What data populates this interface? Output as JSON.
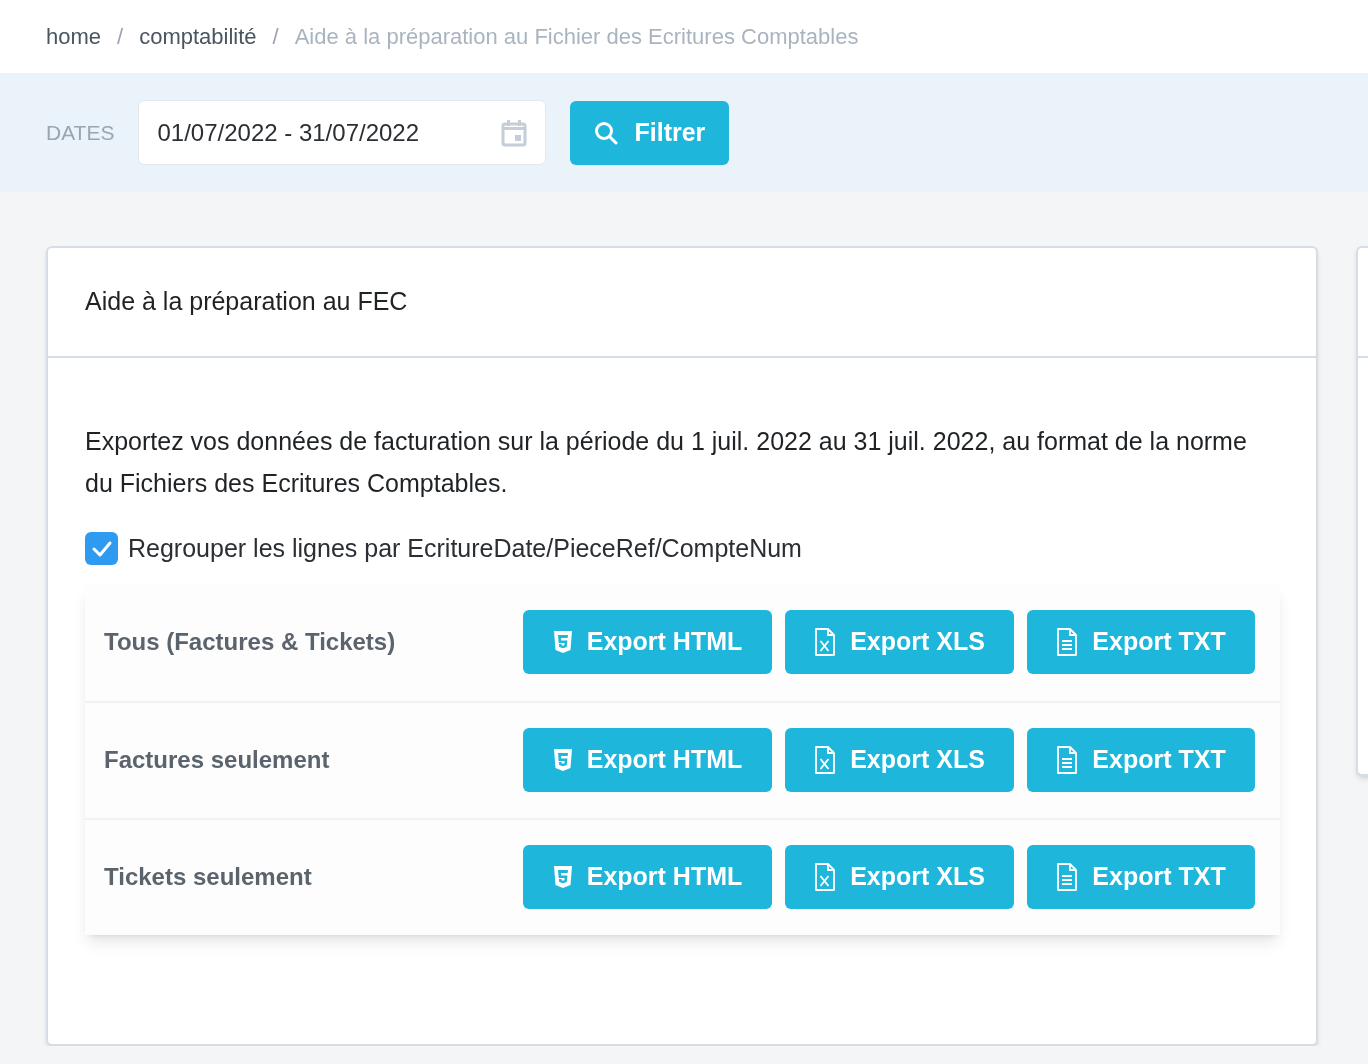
{
  "breadcrumb_separator": "/",
  "breadcrumb": [
    {
      "label": "home",
      "current": false
    },
    {
      "label": "comptabilité",
      "current": false
    },
    {
      "label": "Aide à la préparation au Fichier des Ecritures Comptables",
      "current": true
    }
  ],
  "filter": {
    "label": "DATES",
    "value": "01/07/2022 - 31/07/2022",
    "button": "Filtrer"
  },
  "card": {
    "title": "Aide à la préparation au FEC",
    "description": "Exportez vos données de facturation sur la période du 1 juil. 2022 au 31 juil. 2022, au format de la norme du Fichiers des Ecritures Comptables.",
    "checkbox": {
      "label": "Regrouper les lignes par EcritureDate/PieceRef/CompteNum",
      "checked": true
    },
    "rows": [
      {
        "label": "Tous (Factures & Tickets)",
        "buttons": [
          {
            "kind": "html",
            "label": "Export HTML"
          },
          {
            "kind": "xls",
            "label": "Export XLS"
          },
          {
            "kind": "txt",
            "label": "Export TXT"
          }
        ]
      },
      {
        "label": "Factures seulement",
        "buttons": [
          {
            "kind": "html",
            "label": "Export HTML"
          },
          {
            "kind": "xls",
            "label": "Export XLS"
          },
          {
            "kind": "txt",
            "label": "Export TXT"
          }
        ]
      },
      {
        "label": "Tickets seulement",
        "buttons": [
          {
            "kind": "html",
            "label": "Export HTML"
          },
          {
            "kind": "xls",
            "label": "Export XLS"
          },
          {
            "kind": "txt",
            "label": "Export TXT"
          }
        ]
      }
    ]
  }
}
